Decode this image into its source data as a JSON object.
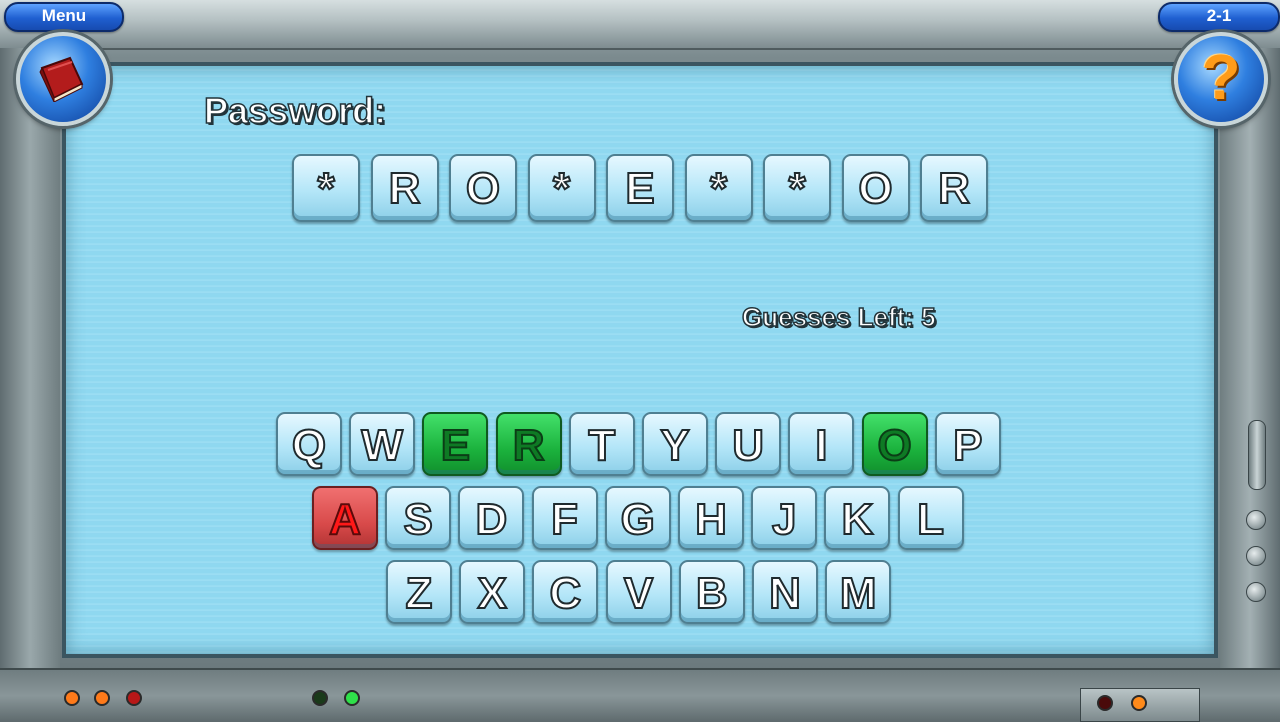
{
  "header": {
    "menu_label": "Menu",
    "level_label": "2-1"
  },
  "buttons": {
    "journal_icon": "book-icon",
    "help_icon": "question-mark-icon",
    "help_symbol": "?"
  },
  "password": {
    "label": "Password:",
    "slots": [
      "*",
      "R",
      "O",
      "*",
      "E",
      "*",
      "*",
      "O",
      "R"
    ]
  },
  "guesses_text": "Guesses Left: 5",
  "keyboard": {
    "rows": [
      [
        {
          "letter": "Q",
          "state": "unused"
        },
        {
          "letter": "W",
          "state": "unused"
        },
        {
          "letter": "E",
          "state": "correct"
        },
        {
          "letter": "R",
          "state": "correct"
        },
        {
          "letter": "T",
          "state": "unused"
        },
        {
          "letter": "Y",
          "state": "unused"
        },
        {
          "letter": "U",
          "state": "unused"
        },
        {
          "letter": "I",
          "state": "unused"
        },
        {
          "letter": "O",
          "state": "correct"
        },
        {
          "letter": "P",
          "state": "unused"
        }
      ],
      [
        {
          "letter": "A",
          "state": "wrong"
        },
        {
          "letter": "S",
          "state": "unused"
        },
        {
          "letter": "D",
          "state": "unused"
        },
        {
          "letter": "F",
          "state": "unused"
        },
        {
          "letter": "G",
          "state": "unused"
        },
        {
          "letter": "H",
          "state": "unused"
        },
        {
          "letter": "J",
          "state": "unused"
        },
        {
          "letter": "K",
          "state": "unused"
        },
        {
          "letter": "L",
          "state": "unused"
        }
      ],
      [
        {
          "letter": "Z",
          "state": "unused"
        },
        {
          "letter": "X",
          "state": "unused"
        },
        {
          "letter": "C",
          "state": "unused"
        },
        {
          "letter": "V",
          "state": "unused"
        },
        {
          "letter": "B",
          "state": "unused"
        },
        {
          "letter": "N",
          "state": "unused"
        },
        {
          "letter": "M",
          "state": "unused"
        }
      ]
    ]
  },
  "colors": {
    "correct": "#1bb23d",
    "wrong": "#d84a4a",
    "screen": "#8fd8f0",
    "pill": "#1f5fd0"
  }
}
